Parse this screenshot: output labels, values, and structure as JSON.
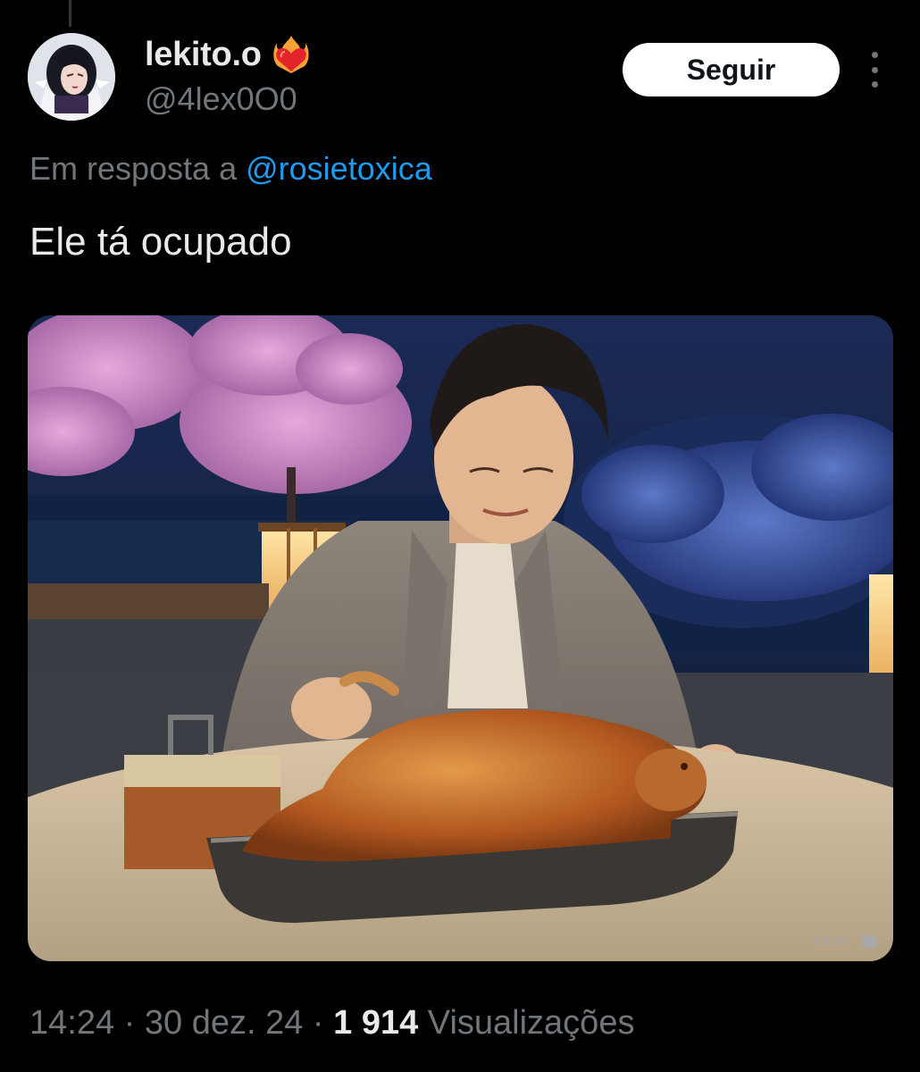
{
  "tweet": {
    "display_name": "lekito.o",
    "handle": "@4lex0O0",
    "follow_label": "Seguir",
    "reply_prefix": "Em resposta a",
    "reply_to": "@rosietoxica",
    "text": "Ele tá ocupado",
    "media_watermark": "GROK",
    "time": "14:24",
    "date": "30 dez. 24",
    "separator": "·",
    "views_count": "1 914",
    "views_label": "Visualizações"
  },
  "icons": {
    "name_badge": "flaming-heart-icon",
    "more": "more-vertical-icon"
  },
  "colors": {
    "background": "#000000",
    "primary_text": "#e7e9ea",
    "secondary_text": "#71767b",
    "link": "#1d9bf0",
    "follow_button_bg": "#ffffff"
  }
}
